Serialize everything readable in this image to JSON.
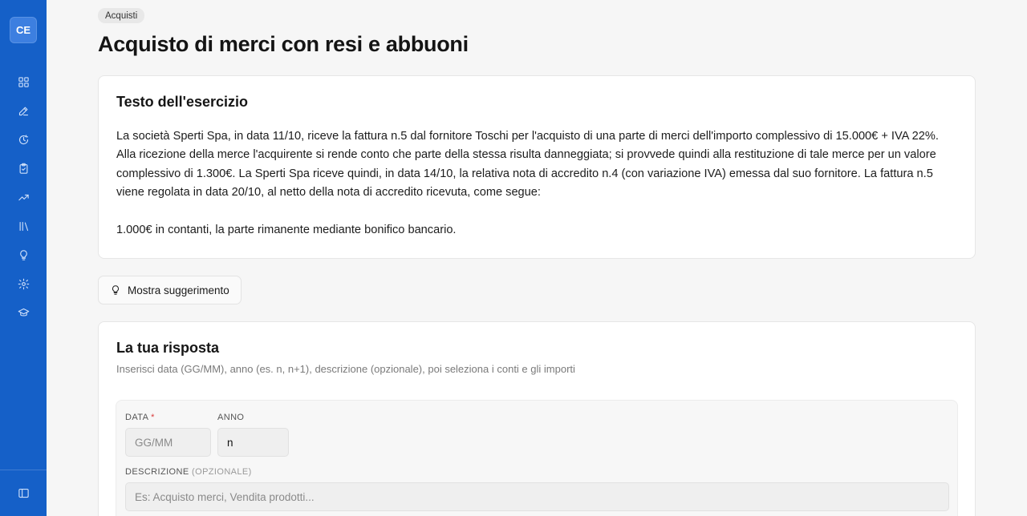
{
  "sidebar": {
    "logo": "CE",
    "items": [
      {
        "icon": "dashboard-icon"
      },
      {
        "icon": "pencil-icon"
      },
      {
        "icon": "history-icon"
      },
      {
        "icon": "clipboard-check-icon"
      },
      {
        "icon": "trending-up-icon"
      },
      {
        "icon": "library-icon"
      },
      {
        "icon": "lightbulb-icon"
      },
      {
        "icon": "gear-icon"
      },
      {
        "icon": "graduation-cap-icon"
      }
    ],
    "bottom_icon": "sidebar-toggle-icon"
  },
  "page": {
    "badge": "Acquisti",
    "title": "Acquisto di merci con resi e abbuoni"
  },
  "exercise": {
    "heading": "Testo dell'esercizio",
    "paragraph1": "La società Sperti Spa, in data 11/10, riceve la fattura n.5 dal fornitore Toschi per l'acquisto di una parte di merci dell'importo complessivo di 15.000€ + IVA 22%. Alla ricezione della merce l'acquirente si rende conto che parte della stessa risulta danneggiata; si provvede quindi alla restituzione di tale merce per un valore complessivo di 1.300€. La Sperti Spa riceve quindi, in data 14/10, la relativa nota di accredito n.4 (con variazione IVA) emessa dal suo fornitore. La fattura n.5 viene regolata in data 20/10, al netto della nota di accredito ricevuta, come segue:",
    "paragraph2": "1.000€ in contanti, la parte rimanente mediante bonifico bancario."
  },
  "hint": {
    "label": "Mostra suggerimento"
  },
  "answer": {
    "heading": "La tua risposta",
    "subtitle": "Inserisci data (GG/MM), anno (es. n, n+1), descrizione (opzionale), poi seleziona i conti e gli importi",
    "date_label": "DATA",
    "required_mark": "*",
    "date_placeholder": "GG/MM",
    "year_label": "ANNO",
    "year_value": "n",
    "desc_label": "DESCRIZIONE",
    "desc_optional": "(OPZIONALE)",
    "desc_placeholder": "Es: Acquisto merci, Vendita prodotti..."
  }
}
